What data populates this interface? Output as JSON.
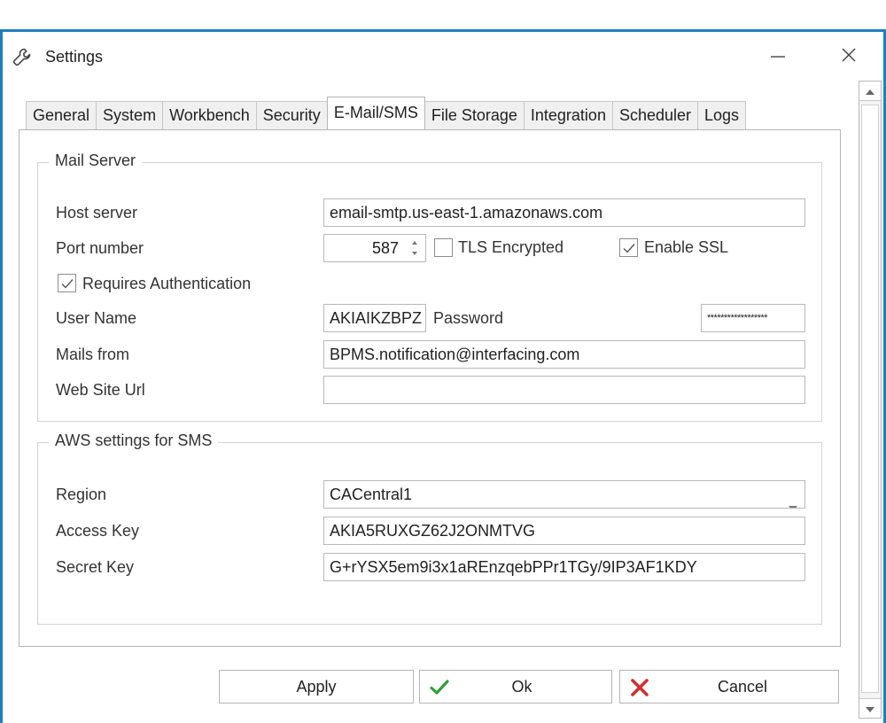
{
  "window": {
    "title": "Settings"
  },
  "tabs": [
    {
      "label": "General"
    },
    {
      "label": "System"
    },
    {
      "label": "Workbench"
    },
    {
      "label": "Security"
    },
    {
      "label": "E-Mail/SMS",
      "active": true
    },
    {
      "label": "File Storage"
    },
    {
      "label": "Integration"
    },
    {
      "label": "Scheduler"
    },
    {
      "label": "Logs"
    }
  ],
  "mail_server": {
    "legend": "Mail Server",
    "host_label": "Host server",
    "host_value": "email-smtp.us-east-1.amazonaws.com",
    "port_label": "Port number",
    "port_value": "587",
    "tls_label": "TLS Encrypted",
    "tls_checked": false,
    "ssl_label": "Enable SSL",
    "ssl_checked": true,
    "auth_label": "Requires Authentication",
    "auth_checked": true,
    "username_label": "User Name",
    "username_value": "AKIAIKZBPZ",
    "password_label": "Password",
    "password_value": "******************",
    "mails_from_label": "Mails from",
    "mails_from_value": "BPMS.notification@interfacing.com",
    "website_label": "Web Site Url",
    "website_value": ""
  },
  "aws": {
    "legend": "AWS settings for SMS",
    "region_label": "Region",
    "region_value": "CACentral1",
    "access_label": "Access Key",
    "access_value": "AKIA5RUXGZ62J2ONMTVG",
    "secret_label": "Secret Key",
    "secret_value": "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"
  },
  "buttons": {
    "apply": "Apply",
    "ok": "Ok",
    "cancel": "Cancel"
  },
  "colors": {
    "window_border": "#1f7ec2",
    "ok_icon": "#2e9e3a",
    "cancel_icon": "#d32f2f"
  },
  "icons": {
    "title": "wrench-icon",
    "minimize": "minimize-icon",
    "close": "close-icon",
    "ok": "checkmark-icon",
    "cancel": "cross-icon"
  }
}
